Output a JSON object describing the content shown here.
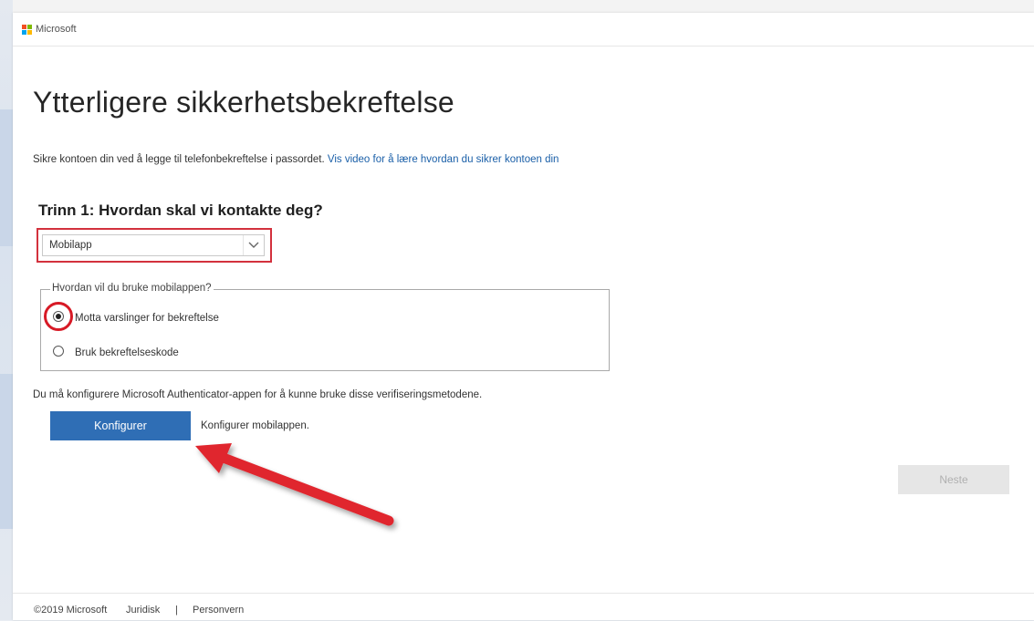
{
  "brand": {
    "logo_icon": "microsoft-logo-icon",
    "name": "Microsoft"
  },
  "page": {
    "title": "Ytterligere sikkerhetsbekreftelse",
    "intro_text": "Sikre kontoen din ved å legge til telefonbekreftelse i passordet.",
    "intro_link": "Vis video for å lære hvordan du sikrer kontoen din"
  },
  "step1": {
    "heading": "Trinn 1: Hvordan skal vi kontakte deg?",
    "selected_method": "Mobilapp",
    "dropdown_icon": "chevron-down-icon"
  },
  "mobile_app": {
    "legend": "Hvordan vil du bruke mobilappen?",
    "options": [
      {
        "label": "Motta varslinger for bekreftelse",
        "selected": true
      },
      {
        "label": "Bruk bekreftelseskode",
        "selected": false
      }
    ],
    "notice": "Du må konfigurere Microsoft Authenticator-appen for å kunne bruke disse verifiseringsmetodene.",
    "configure_button": "Konfigurer",
    "configure_hint": "Konfigurer mobilappen."
  },
  "next_button": "Neste",
  "footer": {
    "copyright": "©2019 Microsoft",
    "legal_link": "Juridisk",
    "separator": "|",
    "privacy_link": "Personvern"
  },
  "colors": {
    "accent": "#2f6eb5",
    "link": "#1a5fa8",
    "annotation_red": "#d71a26"
  }
}
